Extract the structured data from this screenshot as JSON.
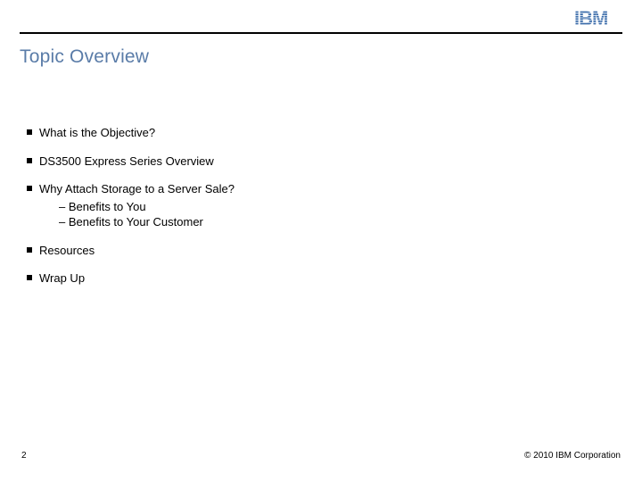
{
  "brand": "IBM",
  "title": "Topic Overview",
  "bullets": [
    {
      "text": "What is the Objective?",
      "subs": []
    },
    {
      "text": "DS3500 Express Series Overview",
      "subs": []
    },
    {
      "text": "Why Attach Storage to a Server Sale?",
      "subs": [
        "Benefits to You",
        "Benefits to Your Customer"
      ]
    },
    {
      "text": "Resources",
      "subs": []
    },
    {
      "text": "Wrap Up",
      "subs": []
    }
  ],
  "page_number": "2",
  "copyright": "© 2010 IBM Corporation",
  "colors": {
    "title": "#5a7ca8",
    "logo": "#3b6caa"
  }
}
